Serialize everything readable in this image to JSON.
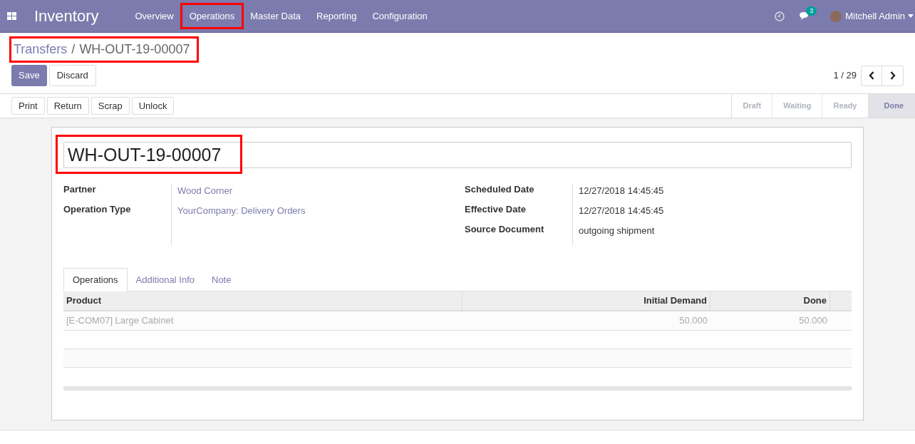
{
  "navbar": {
    "app": "Inventory",
    "menu": [
      {
        "label": "Overview",
        "highlighted": false
      },
      {
        "label": "Operations",
        "highlighted": true
      },
      {
        "label": "Master Data",
        "highlighted": false
      },
      {
        "label": "Reporting",
        "highlighted": false
      },
      {
        "label": "Configuration",
        "highlighted": false
      }
    ],
    "messages_badge": "3",
    "user": "Mitchell Admin"
  },
  "breadcrumb": {
    "parent": "Transfers",
    "separator": "/",
    "current": "WH-OUT-19-00007",
    "highlighted": true
  },
  "buttons": [
    "Save",
    "Discard"
  ],
  "pager": "1 / 29",
  "actions": [
    "Print",
    "Return",
    "Scrap",
    "Unlock"
  ],
  "statusbar": [
    {
      "label": "Draft",
      "selected": false
    },
    {
      "label": "Waiting",
      "selected": false
    },
    {
      "label": "Ready",
      "selected": false
    },
    {
      "label": "Done",
      "selected": true
    }
  ],
  "form": {
    "name": "WH-OUT-19-00007",
    "name_highlighted": true,
    "left_fields": [
      {
        "label": "Partner",
        "value": "Wood Corner",
        "kind": "link"
      },
      {
        "label": "Operation Type",
        "value": "YourCompany: Delivery Orders",
        "kind": "link"
      }
    ],
    "right_fields": [
      {
        "label": "Scheduled Date",
        "value": "12/27/2018 14:45:45",
        "kind": "text"
      },
      {
        "label": "Effective Date",
        "value": "12/27/2018 14:45:45",
        "kind": "text"
      },
      {
        "label": "Source Document",
        "value": "outgoing shipment",
        "kind": "text"
      }
    ],
    "tabs": [
      {
        "label": "Operations",
        "selected": true
      },
      {
        "label": "Additional Info",
        "selected": false
      },
      {
        "label": "Note",
        "selected": false
      }
    ],
    "table": {
      "columns": [
        "Product",
        "Initial Demand",
        "Done"
      ],
      "rows": [
        [
          "[E-COM07] Large Cabinet",
          "50.000",
          "50.000"
        ]
      ]
    }
  }
}
